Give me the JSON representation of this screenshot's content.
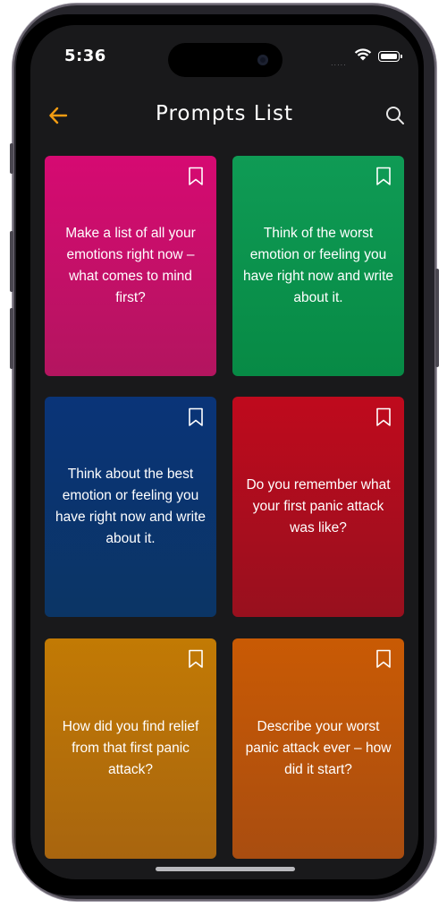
{
  "status_bar": {
    "time": "5:36",
    "signal_dots": "....."
  },
  "header": {
    "title": "Prompts List",
    "back_icon": "arrow-left-icon",
    "search_icon": "search-icon"
  },
  "colors": {
    "accent": "#f39c12",
    "background": "#19191b"
  },
  "prompts": [
    {
      "text": "Make a list of all your emotions right now – what comes to mind first?",
      "color_top": "#d60a72",
      "color_bottom": "#b3155f"
    },
    {
      "text": "Think of the worst emotion or feeling you have right now and write about it.",
      "color_top": "#0f9b55",
      "color_bottom": "#078a45"
    },
    {
      "text": "Think about the best emotion or feeling you have right now and write about it.",
      "color_top": "#0a3478",
      "color_bottom": "#0b3565"
    },
    {
      "text": "Do you remember what your first panic attack was like?",
      "color_top": "#bf0a1d",
      "color_bottom": "#98101e"
    },
    {
      "text": "How did you find relief from that first panic attack?",
      "color_top": "#c27a04",
      "color_bottom": "#a8650f"
    },
    {
      "text": "Describe your worst panic attack ever – how did it start?",
      "color_top": "#c95a04",
      "color_bottom": "#a94d10"
    }
  ]
}
